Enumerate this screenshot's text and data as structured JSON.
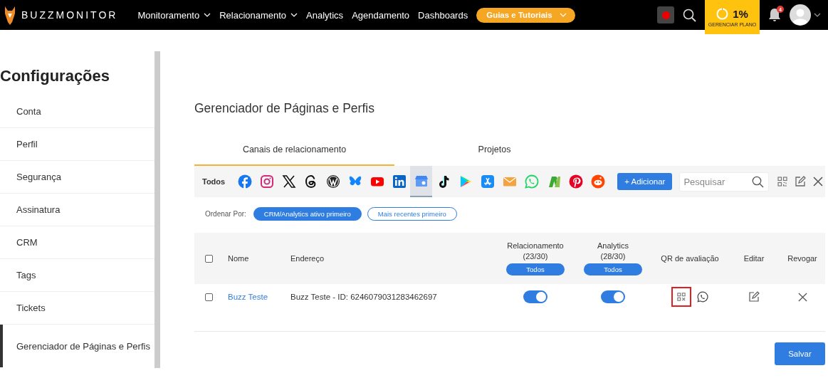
{
  "header": {
    "brand": "**BUZZ**MONITOR",
    "nav": [
      {
        "label": "Monitoramento",
        "dropdown": true
      },
      {
        "label": "Relacionamento",
        "dropdown": true
      },
      {
        "label": "Analytics",
        "dropdown": false
      },
      {
        "label": "Agendamento",
        "dropdown": false
      },
      {
        "label": "Dashboards",
        "dropdown": false
      }
    ],
    "guide_button": "Guias e Tutoriais",
    "recording": true,
    "plan": {
      "percent": "1%",
      "label": "GERENCIAR PLANO"
    },
    "notifications": "4"
  },
  "sidebar": {
    "title": "Configurações",
    "items": [
      {
        "label": "Conta",
        "selected": false
      },
      {
        "label": "Perfil",
        "selected": false
      },
      {
        "label": "Segurança",
        "selected": false
      },
      {
        "label": "Assinatura",
        "selected": false
      },
      {
        "label": "CRM",
        "selected": false
      },
      {
        "label": "Tags",
        "selected": false
      },
      {
        "label": "Tickets",
        "selected": false
      },
      {
        "label": "Gerenciador de Páginas e Perfis",
        "selected": true
      }
    ]
  },
  "page": {
    "title": "Gerenciador de Páginas e Perfis",
    "tabs": [
      {
        "label": "Canais de relacionamento",
        "selected": true
      },
      {
        "label": "Projetos",
        "selected": false
      }
    ],
    "filter": {
      "all_label": "Todos",
      "channels": [
        {
          "kind": "facebook",
          "selected": false
        },
        {
          "kind": "instagram",
          "selected": false
        },
        {
          "kind": "x",
          "selected": false
        },
        {
          "kind": "threads",
          "selected": false
        },
        {
          "kind": "wordpress",
          "selected": false
        },
        {
          "kind": "bluesky",
          "selected": false
        },
        {
          "kind": "youtube",
          "selected": false
        },
        {
          "kind": "linkedin",
          "selected": false
        },
        {
          "kind": "store",
          "selected": true
        },
        {
          "kind": "tiktok",
          "selected": false
        },
        {
          "kind": "play",
          "selected": false
        },
        {
          "kind": "appstore",
          "selected": false
        },
        {
          "kind": "email",
          "selected": false
        },
        {
          "kind": "whatsapp",
          "selected": false
        },
        {
          "kind": "reclame",
          "selected": false
        },
        {
          "kind": "pinterest",
          "selected": false
        },
        {
          "kind": "reddit",
          "selected": false
        }
      ],
      "add_button": "+ Adicionar",
      "search_placeholder": "Pesquisar"
    },
    "sort": {
      "label": "Ordenar Por:",
      "options": [
        {
          "label": "CRM/Analytics ativo primeiro",
          "selected": true
        },
        {
          "label": "Mais recentes primeiro",
          "selected": false
        }
      ]
    },
    "table": {
      "columns": [
        {
          "kind": "checkbox",
          "checked": false
        },
        {
          "kind": "text",
          "label": "Nome"
        },
        {
          "kind": "text",
          "label": "Endereço"
        },
        {
          "kind": "toggle",
          "label": "Relacionamento",
          "count": "(23/30)",
          "button": "Todos"
        },
        {
          "kind": "toggle",
          "label": "Analytics",
          "count": "(28/30)",
          "button": "Todos"
        },
        {
          "kind": "center",
          "label": "QR de avaliação"
        },
        {
          "kind": "center",
          "label": "Editar"
        },
        {
          "kind": "center",
          "label": "Revogar"
        }
      ],
      "rows": [
        {
          "checked": false,
          "name": "Buzz Teste",
          "address": "Buzz Teste - ID: 6246079031283462697",
          "relationship_on": true,
          "analytics_on": true,
          "qr_highlighted": true
        }
      ]
    },
    "save_button": "Salvar"
  }
}
